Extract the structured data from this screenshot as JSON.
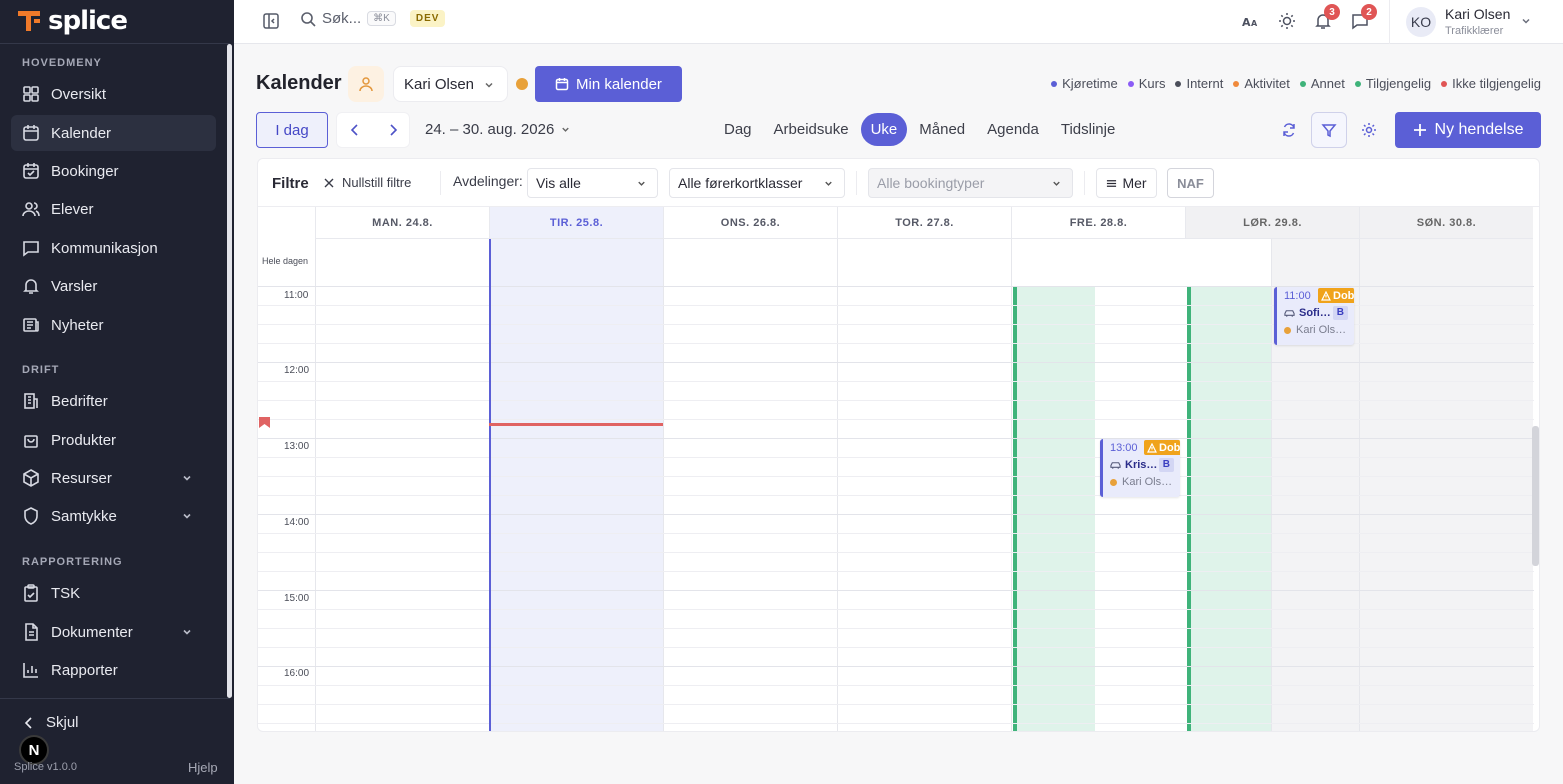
{
  "app": {
    "logo_text": "splice",
    "version": "Splice v1.0.0",
    "help": "Hjelp",
    "hide": "Skjul",
    "badge_letter": "N"
  },
  "sidebar": {
    "sections": [
      {
        "title": "HOVEDMENY",
        "items": [
          {
            "label": "Oversikt",
            "icon": "grid-icon"
          },
          {
            "label": "Kalender",
            "icon": "calendar-icon",
            "active": true
          },
          {
            "label": "Bookinger",
            "icon": "calendar-check-icon"
          },
          {
            "label": "Elever",
            "icon": "users-icon"
          },
          {
            "label": "Kommunikasjon",
            "icon": "message-icon"
          },
          {
            "label": "Varsler",
            "icon": "bell-icon"
          },
          {
            "label": "Nyheter",
            "icon": "newspaper-icon"
          }
        ]
      },
      {
        "title": "DRIFT",
        "items": [
          {
            "label": "Bedrifter",
            "icon": "building-icon"
          },
          {
            "label": "Produkter",
            "icon": "shopping-bag-icon"
          },
          {
            "label": "Resurser",
            "icon": "box-icon",
            "expandable": true
          },
          {
            "label": "Samtykke",
            "icon": "shield-icon",
            "expandable": true
          }
        ]
      },
      {
        "title": "RAPPORTERING",
        "items": [
          {
            "label": "TSK",
            "icon": "clipboard-icon"
          },
          {
            "label": "Dokumenter",
            "icon": "document-icon",
            "expandable": true
          },
          {
            "label": "Rapporter",
            "icon": "bar-chart-icon"
          }
        ]
      }
    ]
  },
  "topbar": {
    "search_placeholder": "Søk...",
    "shortcut": "⌘K",
    "env": "DEV",
    "notifications_count": "3",
    "messages_count": "2",
    "user": {
      "initials": "KO",
      "name": "Kari Olsen",
      "role": "Trafikklærer"
    }
  },
  "header": {
    "title": "Kalender",
    "selected_user": "Kari Olsen",
    "my_calendar": "Min kalender",
    "legend": [
      {
        "label": "Kjøretime",
        "color": "#5b5fd6"
      },
      {
        "label": "Kurs",
        "color": "#8b5cf6"
      },
      {
        "label": "Internt",
        "color": "#4b4e5a"
      },
      {
        "label": "Aktivitet",
        "color": "#f08a3c"
      },
      {
        "label": "Annet",
        "color": "#3fb37a"
      },
      {
        "label": "Tilgjengelig",
        "color": "#3fb37a"
      },
      {
        "label": "Ikke tilgjengelig",
        "color": "#e05555"
      }
    ]
  },
  "toolbar": {
    "today": "I dag",
    "range": "24. – 30. aug. 2026",
    "views": [
      "Dag",
      "Arbeidsuke",
      "Uke",
      "Måned",
      "Agenda",
      "Tidslinje"
    ],
    "active_view": "Uke",
    "new_event": "Ny hendelse"
  },
  "filters": {
    "title": "Filtre",
    "reset": "Nullstill filtre",
    "departments_label": "Avdelinger:",
    "departments_value": "Vis alle",
    "license_classes": "Alle førerkortklasser",
    "booking_types": "Alle bookingtyper",
    "more": "Mer",
    "naf": "NAF"
  },
  "calendar": {
    "all_day_label": "Hele dagen",
    "days": [
      "MAN. 24.8.",
      "TIR. 25.8.",
      "ONS. 26.8.",
      "TOR. 27.8.",
      "FRE. 28.8.",
      "LØR. 29.8.",
      "SØN. 30.8."
    ],
    "hours": [
      "11:00",
      "12:00",
      "13:00",
      "14:00",
      "15:00",
      "16:00"
    ],
    "events": [
      {
        "time": "11:00",
        "warning": "Dob",
        "name": "Sofi…",
        "class": "B",
        "instructor": "Kari Ols…"
      },
      {
        "time": "13:00",
        "warning": "Dob",
        "name": "Kris…",
        "class": "B",
        "instructor": "Kari Ols…"
      }
    ]
  }
}
